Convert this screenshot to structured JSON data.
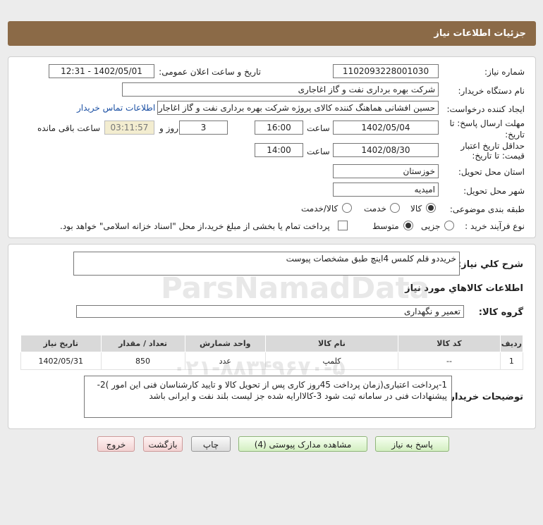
{
  "header": {
    "title": "جزئیات اطلاعات نیاز"
  },
  "form": {
    "need_number_label": "شماره نیاز:",
    "need_number": "1102093228001030",
    "announce_label": "تاریخ و ساعت اعلان عمومی:",
    "announce_value": "1402/05/01 - 12:31",
    "buyer_org_label": "نام دستگاه خریدار:",
    "buyer_org": "شرکت بهره برداری نفت و گاز اغاجاری",
    "creator_label": "ایجاد کننده درخواست:",
    "creator": "حسین افشانی هماهنگ کننده کالای پروژه شرکت بهره برداری نفت و گاز اغاجاری",
    "contact_link": "اطلاعات تماس خریدار",
    "deadline_label_1": "مهلت ارسال پاسخ: تا",
    "deadline_label_2": "تاریخ:",
    "deadline_date": "1402/05/04",
    "time_label": "ساعت",
    "deadline_time": "16:00",
    "days_value": "3",
    "days_label": "روز و",
    "remaining_time": "03:11:57",
    "remaining_label": "ساعت باقی مانده",
    "validity_label_1": "حداقل تاریخ اعتبار",
    "validity_label_2": "قیمت: تا تاریخ:",
    "validity_date": "1402/08/30",
    "validity_time": "14:00",
    "province_label": "استان محل تحویل:",
    "province": "خوزستان",
    "city_label": "شهر محل تحویل:",
    "city": "امیدیه",
    "category_label": "طبقه بندی موضوعی:",
    "category_options": [
      "کالا",
      "خدمت",
      "کالا/خدمت"
    ],
    "process_label": "نوع فرآیند خرید :",
    "process_options": [
      "جزیی",
      "متوسط"
    ],
    "payment_note": "پرداخت تمام یا بخشی از مبلغ خرید،از محل \"اسناد خزانه اسلامی\" خواهد بود."
  },
  "summary": {
    "label": "شرح کلي نياز:",
    "value": "خریددو قلم کلمس 4اینچ طبق مشخصات پیوست",
    "goods_info_title": "اطلاعات کالاهاي مورد نياز",
    "group_label": "گروه کالا:",
    "group_value": "تعمیر و نگهداری"
  },
  "table": {
    "headers": [
      "ردیف",
      "کد کالا",
      "نام کالا",
      "واحد شمارش",
      "تعداد / مقدار",
      "تاریخ نیاز"
    ],
    "rows": [
      [
        "1",
        "--",
        "کلمپ",
        "عدد",
        "850",
        "1402/05/31"
      ]
    ]
  },
  "notes": {
    "label": "توضیحات خریدار:",
    "text": "1-پرداخت اعتباری(زمان پرداخت 45روز کاری پس از تحویل کالا و تایید کارشناسان فنی این امور )2-پیشنهادات فنی در سامانه ثبت شود 3-کالاارایه شده جز لیست بلند نفت و ایرانی باشد"
  },
  "buttons": {
    "reply": "پاسخ به نیاز",
    "docs": "مشاهده مدارک پیوستی (4)",
    "print": "چاپ",
    "back": "بازگشت",
    "exit": "خروج"
  },
  "watermark": {
    "brand": "ParsNamadData",
    "phone": "۰۲۱-۸۸۳۴۹۶۷۰-۵"
  }
}
